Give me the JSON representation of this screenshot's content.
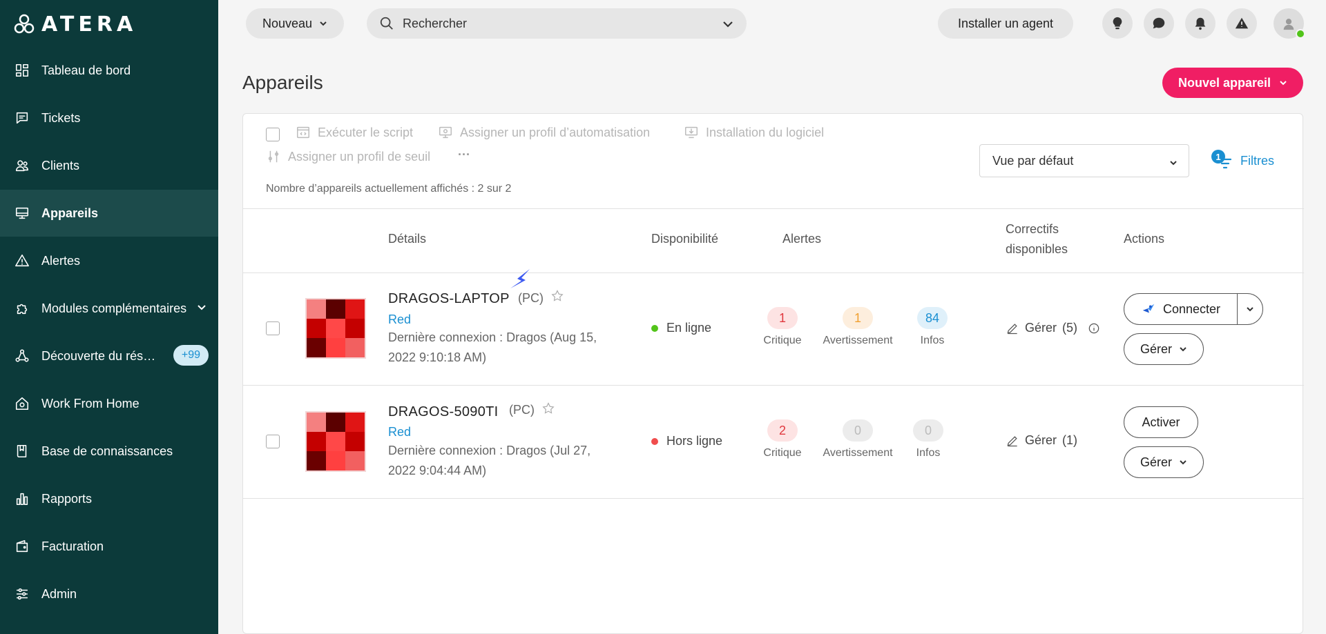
{
  "sidebar": {
    "logo_text": "ATERA",
    "items": [
      {
        "label": "Tableau de bord",
        "icon": "dashboard-icon"
      },
      {
        "label": "Tickets",
        "icon": "ticket-icon"
      },
      {
        "label": "Clients",
        "icon": "clients-icon"
      },
      {
        "label": "Appareils",
        "icon": "devices-icon",
        "active": true
      },
      {
        "label": "Alertes",
        "icon": "alert-icon"
      },
      {
        "label": "Modules complémentaires",
        "icon": "puzzle-icon"
      },
      {
        "label": "Découverte du rés…",
        "icon": "network-icon",
        "badge": "+99"
      },
      {
        "label": "Work From Home",
        "icon": "home-icon"
      },
      {
        "label": "Base de connaissances",
        "icon": "book-icon"
      },
      {
        "label": "Rapports",
        "icon": "chart-icon"
      },
      {
        "label": "Facturation",
        "icon": "wallet-icon"
      },
      {
        "label": "Admin",
        "icon": "sliders-icon"
      }
    ]
  },
  "topbar": {
    "new_label": "Nouveau",
    "search_placeholder": "Rechercher",
    "install_agent_label": "Installer un agent"
  },
  "page": {
    "title": "Appareils",
    "new_device_label": "Nouvel appareil"
  },
  "toolbar": {
    "run_script": "Exécuter le script",
    "assign_automation": "Assigner un profil d’automatisation",
    "software_install": "Installation du logiciel",
    "assign_threshold": "Assigner un profil de seuil",
    "more": "···",
    "count_text": "Nombre d’appareils actuellement affichés : 2 sur 2",
    "view_select": "Vue par défaut",
    "filters_label": "Filtres",
    "filters_count": "1"
  },
  "table": {
    "headers": {
      "details": "Détails",
      "availability": "Disponibilité",
      "alerts": "Alertes",
      "patches_line1": "Correctifs",
      "patches_line2": "disponibles",
      "actions": "Actions"
    },
    "rows": [
      {
        "name": "DRAGOS-LAPTOP",
        "type": "(PC)",
        "client": "Red",
        "last_conn_1": "Dernière connexion : Dragos (Aug 15,",
        "last_conn_2": "2022 9:10:18 AM)",
        "status": "En ligne",
        "status_color": "#52c41a",
        "critical": "1",
        "warning": "1",
        "info": "84",
        "critical_label": "Critique",
        "warning_label": "Avertissement",
        "info_label": "Infos",
        "patch_label": "Gérer",
        "patch_count": "(5)",
        "primary_action": "Connecter",
        "secondary_action": "Gérer"
      },
      {
        "name": "DRAGOS-5090TI",
        "type": "(PC)",
        "client": "Red",
        "last_conn_1": "Dernière connexion : Dragos (Jul 27,",
        "last_conn_2": "2022 9:04:44 AM)",
        "status": "Hors ligne",
        "status_color": "#f04d4d",
        "critical": "2",
        "warning": "0",
        "info": "0",
        "critical_label": "Critique",
        "warning_label": "Avertissement",
        "info_label": "Infos",
        "patch_label": "Gérer",
        "patch_count": "(1)",
        "primary_action": "Activer",
        "secondary_action": "Gérer"
      }
    ]
  },
  "colors": {
    "sidebar_bg": "#0c3a3a",
    "brand_pink": "#f01e64",
    "link_blue": "#1a8fd1"
  }
}
